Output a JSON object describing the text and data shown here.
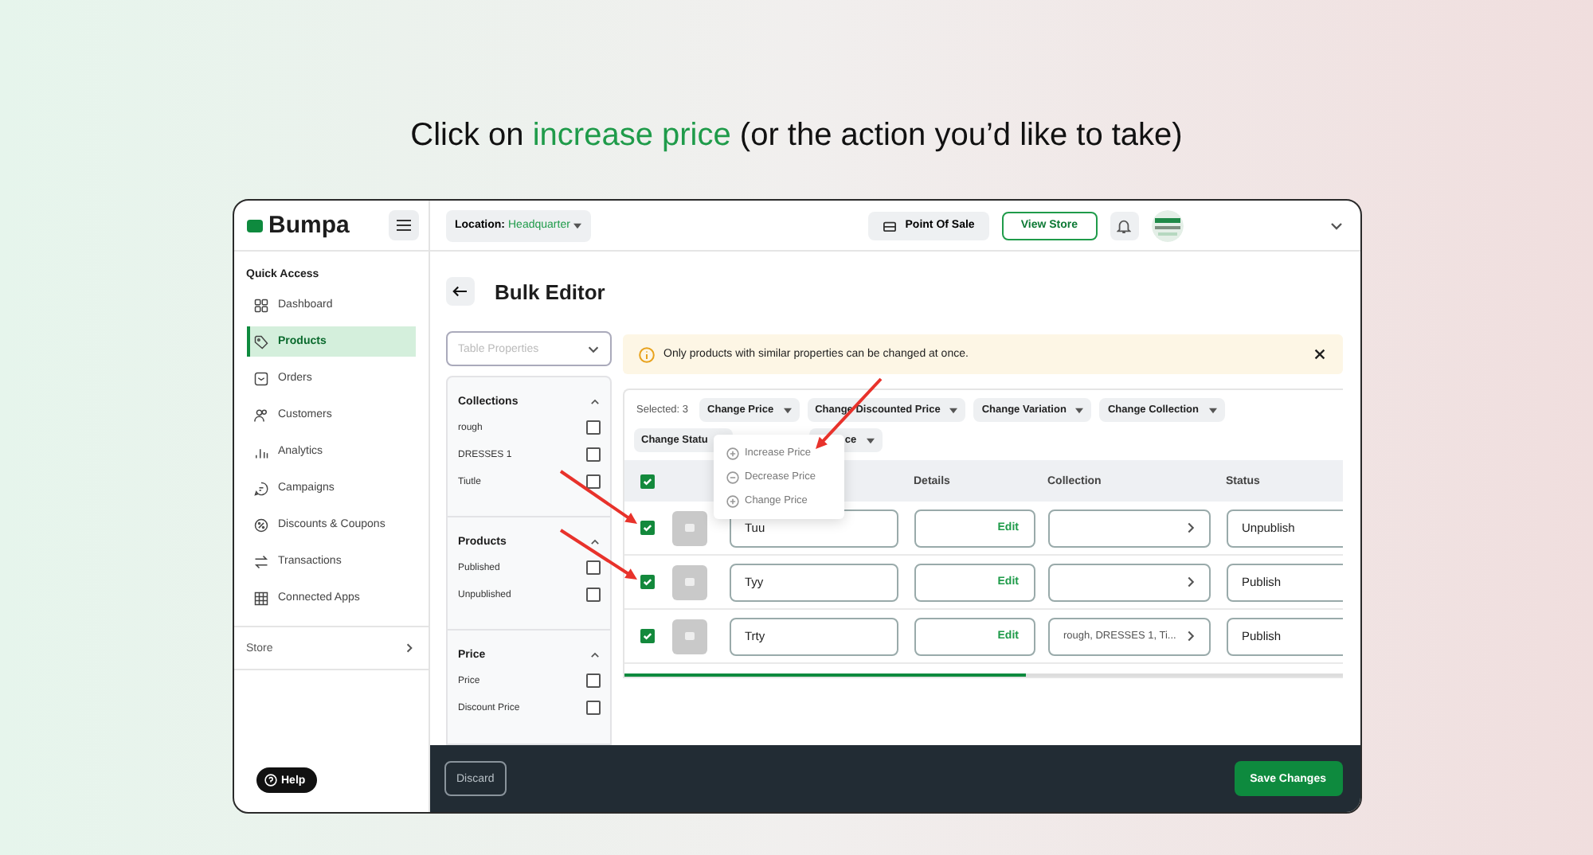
{
  "heading": {
    "before": "Click on ",
    "highlight": "increase price",
    "after": " (or the action you’d like to take)"
  },
  "brand": "Bumpa",
  "sidebar": {
    "section": "Quick Access",
    "items": [
      {
        "label": "Dashboard",
        "selected": false
      },
      {
        "label": "Products",
        "selected": true
      },
      {
        "label": "Orders",
        "selected": false
      },
      {
        "label": "Customers",
        "selected": false
      },
      {
        "label": "Analytics",
        "selected": false
      },
      {
        "label": "Campaigns",
        "selected": false
      },
      {
        "label": "Discounts & Coupons",
        "selected": false
      },
      {
        "label": "Transactions",
        "selected": false
      },
      {
        "label": "Connected Apps",
        "selected": false
      }
    ],
    "store": "Store",
    "help": "Help"
  },
  "topbar": {
    "location_label": "Location:",
    "location_value": "Headquarter",
    "point_of_sale": "Point Of Sale",
    "view_store": "View Store"
  },
  "title": "Bulk Editor",
  "table_properties": {
    "placeholder": "Table Properties"
  },
  "filters": [
    {
      "title": "Collections",
      "expanded": true,
      "options": [
        {
          "label": "rough",
          "checked": false
        },
        {
          "label": "DRESSES 1",
          "checked": false
        },
        {
          "label": "Tiutle",
          "checked": false
        }
      ]
    },
    {
      "title": "Products",
      "expanded": true,
      "options": [
        {
          "label": "Published",
          "checked": false
        },
        {
          "label": "Unpublished",
          "checked": false
        }
      ]
    },
    {
      "title": "Price",
      "expanded": true,
      "options": [
        {
          "label": "Price",
          "checked": false
        },
        {
          "label": "Discount Price",
          "checked": false
        }
      ]
    }
  ],
  "alert": "Only products with similar properties can be changed at once.",
  "selected_count": "Selected: 3",
  "action_rows": [
    [
      "Change Price",
      "Change Discounted Price",
      "Change Variation",
      "Change Collection"
    ],
    [
      "Change Statu",
      "ce"
    ]
  ],
  "menu": [
    {
      "label": "Increase Price",
      "kind": "plus"
    },
    {
      "label": "Decrease Price",
      "kind": "minus"
    },
    {
      "label": "Change Price",
      "kind": "plus"
    }
  ],
  "table": {
    "all_checked": true,
    "columns": [
      "Details",
      "Collection",
      "Status"
    ],
    "rows": [
      {
        "checked": true,
        "name": "Tuu",
        "details": "Edit",
        "collection": "",
        "status": "Unpublish"
      },
      {
        "checked": true,
        "name": "Tyy",
        "details": "Edit",
        "collection": "",
        "status": "Publish"
      },
      {
        "checked": true,
        "name": "Trty",
        "details": "Edit",
        "collection": "rough, DRESSES 1, Ti...",
        "status": "Publish"
      }
    ]
  },
  "footer": {
    "discard": "Discard",
    "save": "Save Changes"
  }
}
